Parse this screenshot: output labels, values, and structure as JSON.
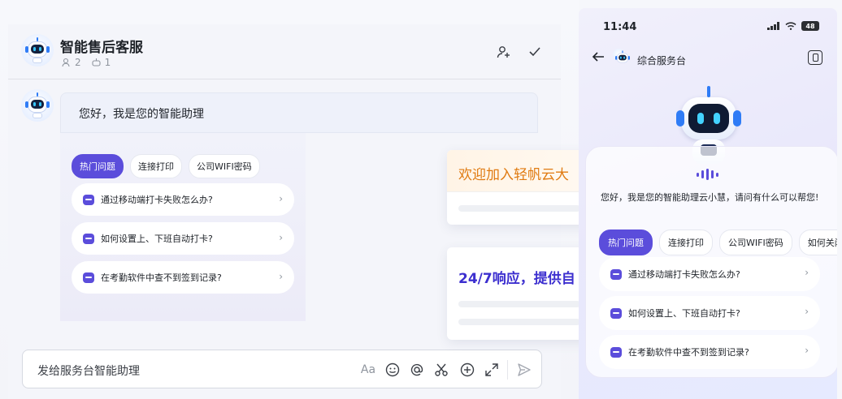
{
  "desktop": {
    "header": {
      "title": "智能售后客服",
      "members": "2",
      "bots": "1"
    },
    "message": {
      "text": "您好，我是您的智能助理"
    },
    "tabs": [
      {
        "label": "热门问题",
        "active": true
      },
      {
        "label": "连接打印",
        "active": false
      },
      {
        "label": "公司WIFI密码",
        "active": false
      }
    ],
    "questions": [
      "通过移动端打卡失败怎么办?",
      "如何设置上、下班自动打卡?",
      "在考勤软件中查不到签到记录?"
    ],
    "float_cards": [
      {
        "text": "欢迎加入轻帆云大",
        "color": "#e07b12"
      },
      {
        "text": "24/7响应，提供自",
        "color": "#3c2fcf"
      }
    ],
    "input": {
      "placeholder": "发给服务台智能助理",
      "font_icon": "Aa"
    }
  },
  "mobile": {
    "status": {
      "time": "11:44",
      "battery": "48"
    },
    "nav": {
      "title": "综合服务台"
    },
    "greeting": "您好，我是您的智能助理云小慧，请问有什么可以帮您!",
    "tabs": [
      {
        "label": "热门问题",
        "active": true
      },
      {
        "label": "连接打印",
        "active": false
      },
      {
        "label": "公司WIFI密码",
        "active": false
      },
      {
        "label": "如何关闭",
        "active": false
      }
    ],
    "questions": [
      "通过移动端打卡失败怎么办?",
      "如何设置上、下班自动打卡?",
      "在考勤软件中查不到签到记录?"
    ]
  },
  "icons": {
    "add_member": "add-user-icon",
    "confirm": "check-icon",
    "emoji": "emoji-icon",
    "mention": "at-icon",
    "scissors": "scissors-icon",
    "plus": "plus-circle-icon",
    "expand": "expand-icon",
    "send": "send-icon"
  },
  "colors": {
    "accent": "#5b4ddb",
    "orange": "#e07b12"
  }
}
